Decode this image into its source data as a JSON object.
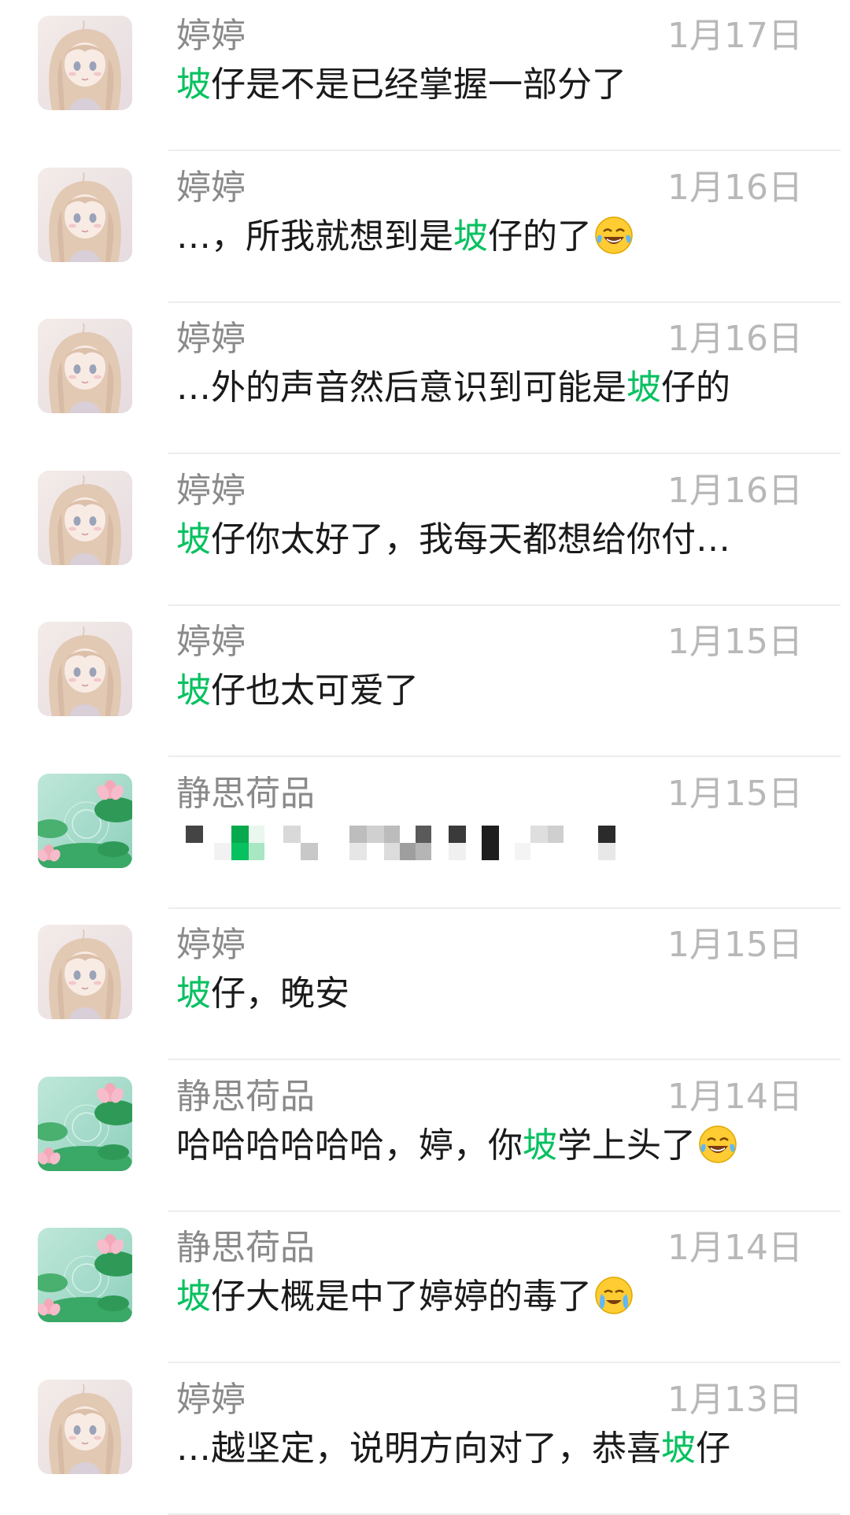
{
  "highlight_color": "#07c160",
  "messages": [
    {
      "name": "婷婷",
      "date": "1月17日",
      "avatar": "girl",
      "segments": [
        {
          "t": "坡",
          "k": true
        },
        {
          "t": "仔是不是已经掌握一部分了",
          "k": false
        }
      ],
      "emoji": ""
    },
    {
      "name": "婷婷",
      "date": "1月16日",
      "avatar": "girl",
      "segments": [
        {
          "t": "…，所我就想到是",
          "k": false
        },
        {
          "t": "坡",
          "k": true
        },
        {
          "t": "仔的了",
          "k": false
        }
      ],
      "emoji": "laugh-tears-emoji"
    },
    {
      "name": "婷婷",
      "date": "1月16日",
      "avatar": "girl",
      "segments": [
        {
          "t": "…外的声音然后意识到可能是",
          "k": false
        },
        {
          "t": "坡",
          "k": true
        },
        {
          "t": "仔的",
          "k": false
        }
      ],
      "emoji": ""
    },
    {
      "name": "婷婷",
      "date": "1月16日",
      "avatar": "girl",
      "segments": [
        {
          "t": "坡",
          "k": true
        },
        {
          "t": "仔你太好了，我每天都想给你付…",
          "k": false
        }
      ],
      "emoji": ""
    },
    {
      "name": "婷婷",
      "date": "1月15日",
      "avatar": "girl",
      "segments": [
        {
          "t": "坡",
          "k": true
        },
        {
          "t": "仔也太可爱了",
          "k": false
        }
      ],
      "emoji": ""
    },
    {
      "name": "静思荷品",
      "date": "1月15日",
      "avatar": "lotus",
      "segments": [],
      "emoji": "",
      "mosaic": true
    },
    {
      "name": "婷婷",
      "date": "1月15日",
      "avatar": "girl",
      "segments": [
        {
          "t": "坡",
          "k": true
        },
        {
          "t": "仔，晚安",
          "k": false
        }
      ],
      "emoji": ""
    },
    {
      "name": "静思荷品",
      "date": "1月14日",
      "avatar": "lotus",
      "segments": [
        {
          "t": "哈哈哈哈哈哈，婷，你",
          "k": false
        },
        {
          "t": "坡",
          "k": true
        },
        {
          "t": "学上头了",
          "k": false
        }
      ],
      "emoji": "laugh-tears-emoji"
    },
    {
      "name": "静思荷品",
      "date": "1月14日",
      "avatar": "lotus",
      "segments": [
        {
          "t": "坡",
          "k": true
        },
        {
          "t": "仔大概是中了婷婷的毒了",
          "k": false
        }
      ],
      "emoji": "crying-emoji"
    },
    {
      "name": "婷婷",
      "date": "1月13日",
      "avatar": "girl",
      "segments": [
        {
          "t": "…越坚定，说明方向对了，恭喜",
          "k": false
        },
        {
          "t": "坡",
          "k": true
        },
        {
          "t": "仔",
          "k": false
        }
      ],
      "emoji": ""
    }
  ]
}
